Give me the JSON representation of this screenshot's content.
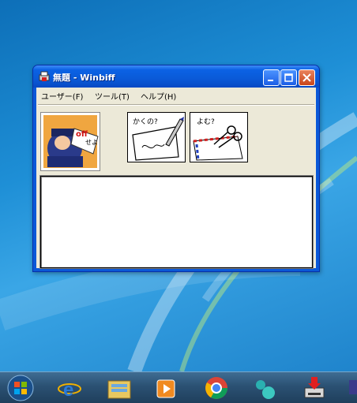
{
  "window": {
    "title": "無題 - Winbiff",
    "icon": "winbiff-printer-icon",
    "controls": {
      "minimize": "minimize-icon",
      "maximize": "maximize-icon",
      "close": "close-icon"
    }
  },
  "menu": {
    "items": [
      {
        "label": "ユーザー(F)"
      },
      {
        "label": "ツール(T)"
      },
      {
        "label": "ヘルプ(H)"
      }
    ]
  },
  "toolbar": {
    "off_stamp": {
      "text_off": "off",
      "text_seyo": "せよ",
      "icon": "mail-carrier-stamp-icon"
    },
    "write_tile": {
      "label": "かくの?",
      "icon": "pen-writing-icon"
    },
    "read_tile": {
      "label": "よむ?",
      "icon": "scissors-envelope-icon"
    }
  },
  "message_area": {
    "value": ""
  },
  "taskbar": {
    "items": [
      {
        "name": "start-orb",
        "icon": "windows-start-icon"
      },
      {
        "name": "internet-explorer",
        "icon": "ie-icon"
      },
      {
        "name": "windows-explorer",
        "icon": "folder-icon"
      },
      {
        "name": "media-player",
        "icon": "media-player-icon"
      },
      {
        "name": "chrome",
        "icon": "chrome-icon"
      },
      {
        "name": "app-bubbles",
        "icon": "bubbles-icon"
      },
      {
        "name": "winbiff",
        "icon": "printer-download-icon"
      }
    ]
  },
  "colors": {
    "title_bar": "#0a5ad8",
    "client_bg": "#ece9d8",
    "desktop": "#1e8fd6",
    "taskbar": "#2b5173"
  }
}
